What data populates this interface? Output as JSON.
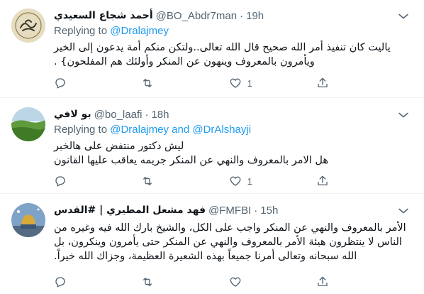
{
  "tweets": [
    {
      "name": "أحمد شجاع السعيدي",
      "handle": "@BO_Abdr7man",
      "dot": "·",
      "time": "19h",
      "replying_prefix": "Replying to",
      "mentions": "@Dralajmey",
      "body": "ياليت كان تنفيذ أمر الله صحيح قال الله تعالى..ولتكن منكم أمة يدعون إلى الخير ويأمرون بالمعروف وينهون عن المنكر وأولئك هم المفلحون} .",
      "retweets": "",
      "likes": "1",
      "avatar_icon": "calligraphy-avatar"
    },
    {
      "name": "بو لافي",
      "handle": "@bo_laafi",
      "dot": "·",
      "time": "18h",
      "replying_prefix": "Replying to",
      "mentions": "@Dralajmey and @DrAlshayji",
      "body_lines": [
        "ليش دكتور منتفض على هالخبر",
        "هل الامر بالمعروف والنهي عن المنكر جريمه يعاقب عليها القانون"
      ],
      "retweets": "",
      "likes": "1",
      "avatar_icon": "landscape-avatar"
    },
    {
      "name": "فهد مشعل المطيري | #القدس",
      "handle": "@FMFBI",
      "dot": "·",
      "time": "15h",
      "body": "الأمر بالمعروف والنهي عن المنكر واجب على الكل، والشيخ بارك الله فيه وغيره من الناس لا ينتظرون هيئة الأمر بالمعروف والنهي عن المنكر حتى يأمرون وينكرون، بل الله سبحانه وتعالى أمرنا جميعاً بهذه الشعيرة العظيمة، وجزاك الله خيراً.",
      "retweets": "",
      "likes": "",
      "avatar_icon": "mosque-avatar"
    }
  ],
  "colors": {
    "accent": "#1d9bf0",
    "muted": "#536471",
    "text": "#0f1419",
    "border": "#eff3f4"
  }
}
